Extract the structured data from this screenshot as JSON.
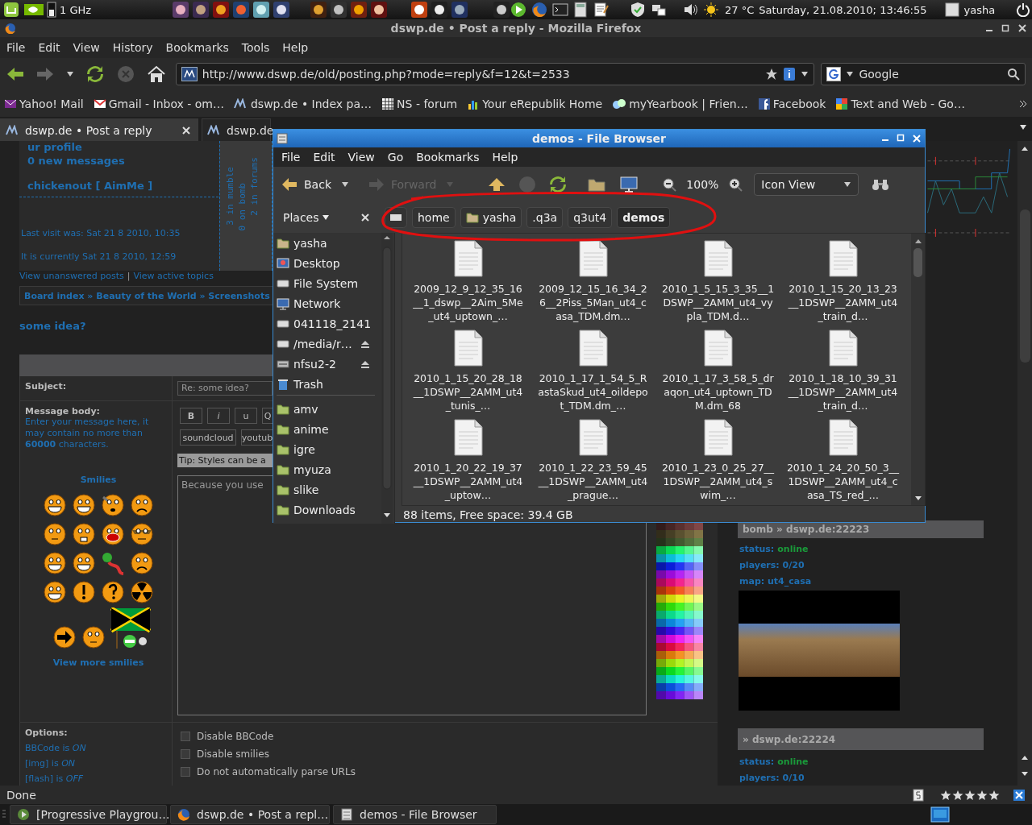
{
  "top_panel": {
    "cpu_frequency": "1 GHz",
    "temperature": "27 °C",
    "clock": "Saturday, 21.08.2010; 13:46:55",
    "user": "yasha"
  },
  "browser": {
    "title": "dswp.de • Post a reply - Mozilla Firefox",
    "menu": [
      "File",
      "Edit",
      "View",
      "History",
      "Bookmarks",
      "Tools",
      "Help"
    ],
    "url": "http://www.dswp.de/old/posting.php?mode=reply&f=12&t=2533",
    "search": {
      "placeholder": "Google"
    },
    "bookmarks": [
      {
        "label": "Yahoo! Mail",
        "kind": "yahoo"
      },
      {
        "label": "Gmail - Inbox - om…",
        "kind": "mail"
      },
      {
        "label": "dswp.de • Index pa…",
        "kind": "site"
      },
      {
        "label": "NS - forum",
        "kind": "grid"
      },
      {
        "label": "Your eRepublik Home",
        "kind": "chart"
      },
      {
        "label": "myYearbook | Frien…",
        "kind": "faces"
      },
      {
        "label": "Facebook",
        "kind": "facebook"
      },
      {
        "label": "Text and Web - Go…",
        "kind": "puzzle"
      }
    ],
    "tabs": [
      {
        "label": "dswp.de • Post a reply",
        "selected": true
      },
      {
        "label": "dswp.de",
        "selected": false
      }
    ],
    "status": "Done",
    "rating": {
      "stars": 5
    }
  },
  "forum": {
    "profile_link": "ur profile",
    "new_messages": "0 new messages",
    "user": "chickenout [ AimMe ]",
    "last_visit": "Last visit was: Sat 21 8 2010, 10:35",
    "current_time": "It is currently Sat 21 8 2010, 12:59",
    "online": [
      "3 in mumble",
      "0 on bomb",
      "2 in forums"
    ],
    "links": [
      "View unanswered posts",
      "View active topics"
    ],
    "link_separator": "|",
    "breadcrumb": "Board index » Beauty of the World » Screenshots",
    "topic": "some idea?",
    "subject_label": "Subject:",
    "subject": "Re: some idea?",
    "body_label": "Message body:",
    "body_hint": "Enter your message here, it may contain no more than **60000** characters.",
    "format_buttons": [
      "B",
      "i",
      "u",
      "Q"
    ],
    "media_buttons": [
      "soundcloud",
      "youtub"
    ],
    "tip": "Tip: Styles can be a",
    "message": "Because you use",
    "smilies_title": "Smilies",
    "more_smilies": "View more smilies",
    "options_title": "Options:",
    "option_status": [
      "BBCode is *ON*",
      "[img] is *ON*",
      "[flash] is *OFF*"
    ],
    "options": [
      {
        "label": "Disable BBCode",
        "checked": false
      },
      {
        "label": "Disable smilies",
        "checked": false
      },
      {
        "label": "Do not automatically parse URLs",
        "checked": false
      }
    ]
  },
  "servers": [
    {
      "title": "bomb » dswp.de:22223",
      "status_label": "status:",
      "status": "online",
      "players": "players: 0/20",
      "map": "map: ut4_casa"
    },
    {
      "title": "» dswp.de:22224",
      "status_label": "status:",
      "status": "online",
      "players": "players: 0/10"
    }
  ],
  "file_browser": {
    "title": "demos - File Browser",
    "menu": [
      "File",
      "Edit",
      "View",
      "Go",
      "Bookmarks",
      "Help"
    ],
    "nav": [
      {
        "label": "Back",
        "disabled": false
      },
      {
        "label": "Forward",
        "disabled": true
      }
    ],
    "zoom": "100%",
    "view": "Icon View",
    "places_label": "Places",
    "path": [
      {
        "label": "home",
        "kind": "plain",
        "selected": false
      },
      {
        "label": "yasha",
        "kind": "home",
        "selected": false
      },
      {
        "label": ".q3a",
        "kind": "plain",
        "selected": false
      },
      {
        "label": "q3ut4",
        "kind": "plain",
        "selected": false
      },
      {
        "label": "demos",
        "kind": "plain",
        "selected": true
      }
    ],
    "places": [
      {
        "label": "yasha",
        "kind": "home",
        "ejectable": false
      },
      {
        "label": "Desktop",
        "kind": "desktop",
        "ejectable": false
      },
      {
        "label": "File System",
        "kind": "drive",
        "ejectable": false
      },
      {
        "label": "Network",
        "kind": "network",
        "ejectable": false
      },
      {
        "label": "041118_2141",
        "kind": "drive",
        "ejectable": false
      },
      {
        "label": "/media/r…",
        "kind": "drive",
        "ejectable": true
      },
      {
        "label": "nfsu2-2",
        "kind": "disk",
        "ejectable": true
      },
      {
        "label": "Trash",
        "kind": "trash",
        "ejectable": false
      }
    ],
    "bookmarks": [
      "amv",
      "anime",
      "igre",
      "myuza",
      "slike",
      "Downloads"
    ],
    "files": [
      "2009_12_9_12_35_16__1_dswp__2Aim_5Me_ut4_uptown_…",
      "2009_12_15_16_34_26__2Piss_5Man_ut4_casa_TDM.dm…",
      "2010_1_5_15_3_35__1DSWP__2AMM_ut4_vypla_TDM.d…",
      "2010_1_15_20_13_23__1DSWP__2AMM_ut4_train_d…",
      "2010_1_15_20_28_18__1DSWP__2AMM_ut4_tunis_…",
      "2010_1_17_1_54_5_RastaSkud_ut4_oildepot_TDM.dm_…",
      "2010_1_17_3_58_5_draqon_ut4_uptown_TDM.dm_68",
      "2010_1_18_10_39_31__1DSWP__2AMM_ut4_train_d…",
      "2010_1_20_22_19_37__1DSWP__2AMM_ut4_uptow…",
      "2010_1_22_23_59_45__1DSWP__2AMM_ut4_prague…",
      "2010_1_23_0_25_27__1DSWP__2AMM_ut4_swim_…",
      "2010_1_24_20_50_3__1DSWP__2AMM_ut4_casa_TS_red_…"
    ],
    "status": "88 items, Free space: 39.4 GB"
  },
  "taskbar": [
    {
      "label": "[Progressive Playgrou…",
      "kind": "player"
    },
    {
      "label": "dswp.de • Post a repl…",
      "kind": "browser"
    },
    {
      "label": "demos - File Browser",
      "kind": "files"
    }
  ]
}
